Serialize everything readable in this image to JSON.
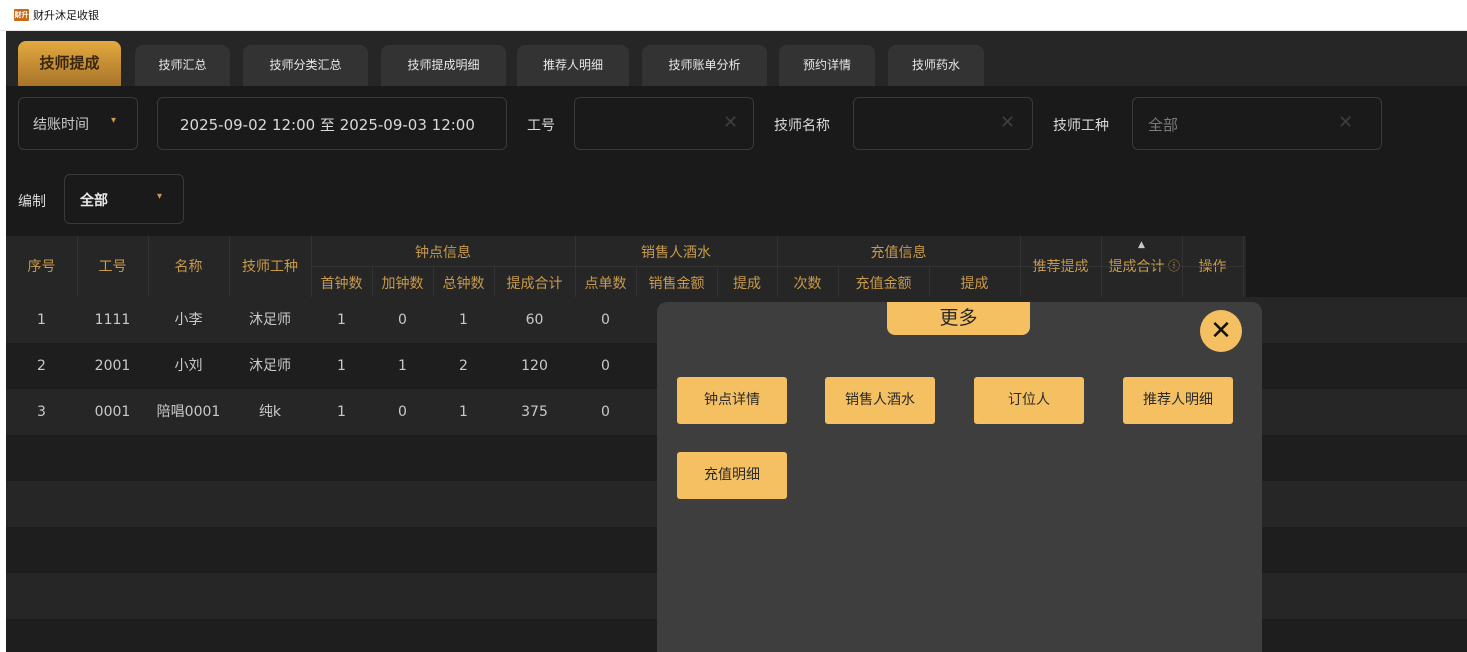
{
  "window": {
    "logo": "财升",
    "title": "财升沐足收银"
  },
  "tabs": [
    "技师提成",
    "技师汇总",
    "技师分类汇总",
    "技师提成明细",
    "推荐人明细",
    "技师账单分析",
    "预约详情",
    "技师药水"
  ],
  "filters": {
    "time_type": "结账时间",
    "date_range": "2025-09-02 12:00 至 2025-09-03 12:00",
    "employee_no_label": "工号",
    "tech_name_label": "技师名称",
    "tech_type_label": "技师工种",
    "tech_type_value": "全部",
    "staffing_label": "编制",
    "staffing_value": "全部"
  },
  "table": {
    "headers": {
      "seq": "序号",
      "emp_no": "工号",
      "name": "名称",
      "tech_type": "技师工种",
      "group_clock": "钟点信息",
      "first_clock": "首钟数",
      "extra_clock": "加钟数",
      "total_clock": "总钟数",
      "commission_total": "提成合计",
      "group_sales": "销售人酒水",
      "order_count": "点单数",
      "sales_amount": "销售金额",
      "sales_commission": "提成",
      "group_recharge": "充值信息",
      "recharge_times": "次数",
      "recharge_amount": "充值金额",
      "recharge_commission": "提成",
      "referral_commission": "推荐提成",
      "grand_total": "提成合计",
      "actions": "操作"
    },
    "rows": [
      [
        "1",
        "1111",
        "小李",
        "沐足师",
        "1",
        "0",
        "1",
        "60",
        "0"
      ],
      [
        "2",
        "2001",
        "小刘",
        "沐足师",
        "1",
        "1",
        "2",
        "120",
        "0"
      ],
      [
        "3",
        "0001",
        "陪唱0001",
        "纯k",
        "1",
        "0",
        "1",
        "375",
        "0"
      ]
    ]
  },
  "modal": {
    "title": "更多",
    "buttons": [
      "钟点详情",
      "销售人酒水",
      "订位人",
      "推荐人明细",
      "充值明细"
    ]
  },
  "colors": {
    "accent": "#f5c061",
    "header_text": "#c89a4b",
    "background": "#1a1a1a"
  }
}
